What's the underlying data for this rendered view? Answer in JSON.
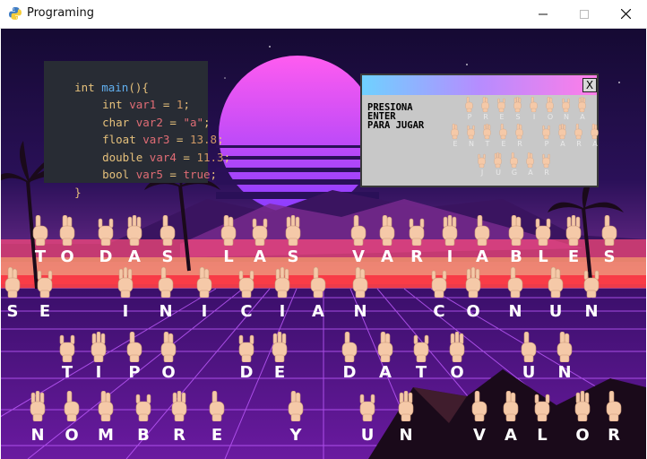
{
  "window": {
    "title": "Programing",
    "app_icon": "python-icon",
    "minimize_icon": "minimize-icon",
    "maximize_icon": "maximize-icon",
    "close_icon": "close-icon"
  },
  "code_panel": {
    "lines": [
      {
        "kw": "int",
        "name": "main",
        "rest": "(){"
      },
      {
        "kw": "int",
        "var": "var1",
        "op": " = ",
        "val": "1",
        "end": ";"
      },
      {
        "kw": "char",
        "var": "var2",
        "op": " = ",
        "val": "\"a\"",
        "end": ";"
      },
      {
        "kw": "float",
        "var": "var3",
        "op": " = ",
        "val": "13.8",
        "end": ";"
      },
      {
        "kw": "double",
        "var": "var4",
        "op": " = ",
        "val": "11.3",
        "end": ";"
      },
      {
        "kw": "bool",
        "var": "var5",
        "op": " = ",
        "val": "true",
        "end": ";"
      },
      {
        "close": "}"
      }
    ]
  },
  "popup": {
    "text_lines": [
      "PRESIONA",
      "ENTER",
      "PARA JUGAR"
    ],
    "close_label": "X",
    "close_icon": "close-icon",
    "sign_words": [
      "PRESIONA",
      "ENTER PARA",
      "JUGAR"
    ]
  },
  "sign_rows": [
    [
      "T",
      "O",
      "D",
      "A",
      "S",
      "L",
      "A",
      "S",
      "V",
      "A",
      "R",
      "I",
      "A",
      "B",
      "L",
      "E",
      "S"
    ],
    [
      "S",
      "E",
      "I",
      "N",
      "I",
      "C",
      "I",
      "A",
      "N",
      "C",
      "O",
      "N",
      "U",
      "N"
    ],
    [
      "T",
      "I",
      "P",
      "O",
      "D",
      "E",
      "D",
      "A",
      "T",
      "O",
      "U",
      "N"
    ],
    [
      "N",
      "O",
      "M",
      "B",
      "R",
      "E",
      "Y",
      "U",
      "N",
      "V",
      "A",
      "L",
      "O",
      "R"
    ]
  ],
  "colors": {
    "sky_top": "#1a0a3a",
    "sun_top": "#ff5cf0",
    "sun_bottom": "#a43cff",
    "grid": "#b04cff",
    "hand_skin": "#f5c9a8"
  }
}
